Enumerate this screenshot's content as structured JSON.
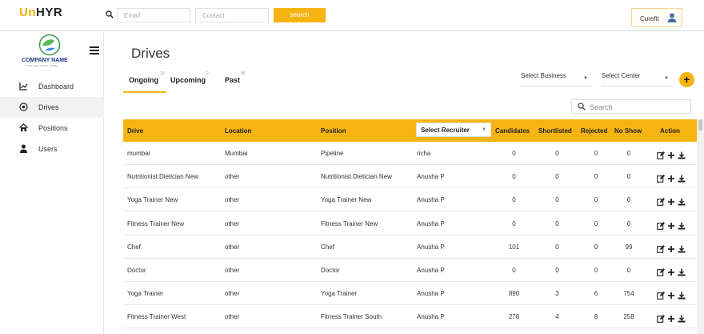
{
  "app": {
    "logo_prefix": "Un",
    "logo_suffix": "HYR",
    "email_placeholder": "Email",
    "contact_placeholder": "Contact",
    "search_button": "search",
    "user_name": "Curefit"
  },
  "sidebar": {
    "company_name": "COMPANY NAME",
    "company_tagline": "TAGLINE GOES HERE",
    "items": [
      {
        "label": "Dashboard",
        "icon": "chart-icon",
        "active": false
      },
      {
        "label": "Drives",
        "icon": "drive-icon",
        "active": true
      },
      {
        "label": "Positions",
        "icon": "home-icon",
        "active": false
      },
      {
        "label": "Users",
        "icon": "user-icon",
        "active": false
      }
    ]
  },
  "main": {
    "title": "Drives",
    "tabs": [
      {
        "label": "Ongoing",
        "count": "13",
        "active": true
      },
      {
        "label": "Upcoming",
        "count": "2",
        "active": false
      },
      {
        "label": "Past",
        "count": "88",
        "active": false
      }
    ],
    "filters": {
      "business": "Select Business",
      "center": "Select Center"
    },
    "add_label": "+",
    "search_placeholder": "Search"
  },
  "table": {
    "headers": {
      "drive": "Drive",
      "location": "Location",
      "position": "Position",
      "recruiter": "Select Recruiter",
      "candidates": "Candidates",
      "shortlisted": "Shortlisted",
      "rejected": "Rejected",
      "no_show": "No Show",
      "action": "Action"
    },
    "rows": [
      {
        "drive": "mumbai",
        "location": "Mumbai",
        "position": "Pipeline",
        "recruiter": "richa",
        "candidates": "0",
        "shortlisted": "0",
        "rejected": "0",
        "no_show": "0"
      },
      {
        "drive": "Nutritionist Dietician New",
        "location": "other",
        "position": "Nutritionist Dietician New",
        "recruiter": "Anusha P",
        "candidates": "0",
        "shortlisted": "0",
        "rejected": "0",
        "no_show": "0"
      },
      {
        "drive": "Yoga Trainer New",
        "location": "other",
        "position": "Yoga Trainer New",
        "recruiter": "Anusha P",
        "candidates": "0",
        "shortlisted": "0",
        "rejected": "0",
        "no_show": "0"
      },
      {
        "drive": "Fitness Trainer New",
        "location": "other",
        "position": "Fitness Trainer New",
        "recruiter": "Anusha P",
        "candidates": "0",
        "shortlisted": "0",
        "rejected": "0",
        "no_show": "0"
      },
      {
        "drive": "Chef",
        "location": "other",
        "position": "Chef",
        "recruiter": "Anusha P",
        "candidates": "101",
        "shortlisted": "0",
        "rejected": "0",
        "no_show": "99"
      },
      {
        "drive": "Doctor",
        "location": "other",
        "position": "Doctor",
        "recruiter": "Anusha P",
        "candidates": "0",
        "shortlisted": "0",
        "rejected": "0",
        "no_show": "0"
      },
      {
        "drive": "Yoga Trainer",
        "location": "other",
        "position": "Yoga Trainer",
        "recruiter": "Anusha P",
        "candidates": "890",
        "shortlisted": "3",
        "rejected": "6",
        "no_show": "754"
      },
      {
        "drive": "Fitness Trainer West",
        "location": "other",
        "position": "Fitness Trainer South",
        "recruiter": "Anusha P",
        "candidates": "278",
        "shortlisted": "4",
        "rejected": "8",
        "no_show": "258"
      }
    ]
  },
  "colors": {
    "accent": "#f5b412",
    "brand_dark": "#1f3b8a"
  }
}
